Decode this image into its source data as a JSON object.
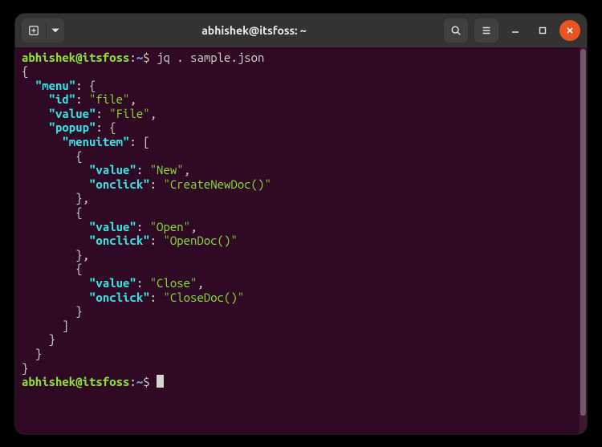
{
  "window": {
    "title": "abhishek@itsfoss: ~"
  },
  "prompt": {
    "user": "abhishek",
    "at": "@",
    "host": "itsfoss",
    "colon": ":",
    "path": "~",
    "symbol": "$"
  },
  "command": "jq . sample.json",
  "output": {
    "start": "{",
    "end": "}",
    "menu_key": "\"menu\"",
    "menu_open": ": {",
    "id_key": "\"id\"",
    "id_val": "\"file\"",
    "value_key": "\"value\"",
    "value_val": "\"File\"",
    "popup_key": "\"popup\"",
    "popup_open": ": {",
    "menuitem_key": "\"menuitem\"",
    "menuitem_open": ": [",
    "item_open": "{",
    "item_close": "}",
    "item_close_comma": "},",
    "arr_close": "]",
    "obj_close": "}",
    "val_key": "\"value\"",
    "onclick_key": "\"onclick\"",
    "new_val": "\"New\"",
    "new_onclick": "\"CreateNewDoc()\"",
    "open_val": "\"Open\"",
    "open_onclick": "\"OpenDoc()\"",
    "close_val": "\"Close\"",
    "close_onclick": "\"CloseDoc()\"",
    "comma": ","
  },
  "icons": {
    "new_tab": "new-tab-icon",
    "dropdown": "chevron-down-icon",
    "search": "search-icon",
    "menu": "hamburger-icon",
    "minimize": "minimize-icon",
    "maximize": "maximize-icon",
    "close": "close-icon"
  }
}
